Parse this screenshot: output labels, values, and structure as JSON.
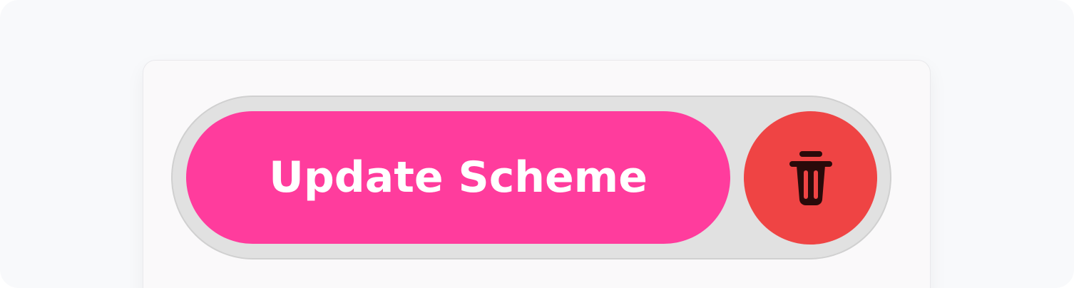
{
  "actions": {
    "update_label": "Update Scheme",
    "delete_icon": "trash-icon"
  },
  "colors": {
    "page_background": "#f8f9fb",
    "panel_background": "#faf9fa",
    "track_background": "#e1e1e1",
    "update_button": "#ff3c9d",
    "delete_button": "#ef4444",
    "icon_color": "#2a0a0a",
    "label_color": "#ffffff"
  }
}
